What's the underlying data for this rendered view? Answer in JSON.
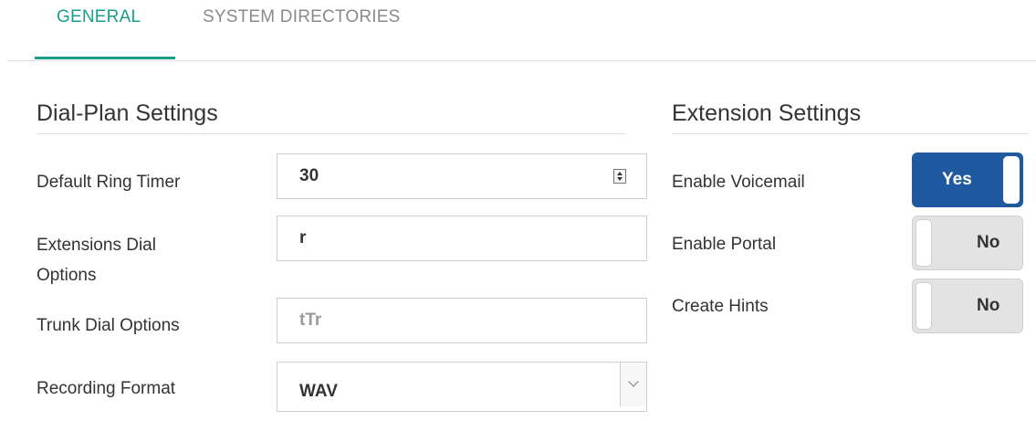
{
  "tabs": [
    {
      "label": "GENERAL",
      "active": true
    },
    {
      "label": "SYSTEM DIRECTORIES",
      "active": false
    }
  ],
  "dial_plan": {
    "title": "Dial-Plan Settings",
    "default_ring_timer": {
      "label": "Default Ring Timer",
      "value": "30"
    },
    "extensions_dial_options": {
      "label_line1": "Extensions Dial",
      "label_line2": "Options",
      "value": "r"
    },
    "trunk_dial_options": {
      "label": "Trunk Dial Options",
      "value": "tTr"
    },
    "recording_format": {
      "label": "Recording Format",
      "value": "WAV"
    }
  },
  "extension_settings": {
    "title": "Extension Settings",
    "enable_voicemail": {
      "label": "Enable Voicemail",
      "state": "Yes"
    },
    "enable_portal": {
      "label": "Enable Portal",
      "state": "No"
    },
    "create_hints": {
      "label": "Create Hints",
      "state": "No"
    }
  },
  "colors": {
    "accent": "#1a9e8c",
    "toggle_on": "#1f5aa0",
    "toggle_off": "#e3e3e3"
  },
  "icons": {
    "stepper": "spinner-arrows-icon",
    "select": "chevron-down-icon"
  }
}
